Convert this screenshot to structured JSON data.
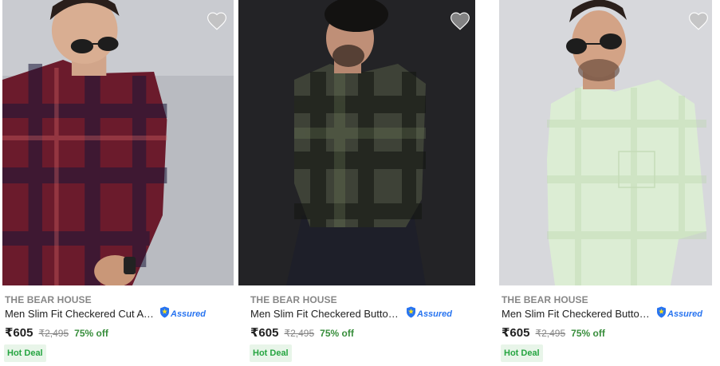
{
  "products": [
    {
      "brand": "THE BEAR HOUSE",
      "title": "Men Slim Fit Checkered Cut Away Collar Casual Shirt",
      "assured": "Assured",
      "price": "₹605",
      "mrp": "₹2,495",
      "discount": "75% off",
      "badge": "Hot Deal",
      "shirt_color": "#6b1b2c",
      "bg_color": "#c9cbd0"
    },
    {
      "brand": "THE BEAR HOUSE",
      "title": "Men Slim Fit Checkered Button Down Collar Casual Shirt",
      "assured": "Assured",
      "price": "₹605",
      "mrp": "₹2,495",
      "discount": "75% off",
      "badge": "Hot Deal",
      "shirt_color": "#3e4237",
      "bg_color": "#1c1c1e"
    },
    {
      "brand": "THE BEAR HOUSE",
      "title": "Men Slim Fit Checkered Button Down Collar Casual Shirt",
      "assured": "Assured",
      "price": "₹605",
      "mrp": "₹2,495",
      "discount": "75% off",
      "badge": "Hot Deal",
      "shirt_color": "#dcedd4",
      "bg_color": "#d7d8dc"
    }
  ],
  "icons": {
    "wishlist": "heart-icon",
    "assured": "shield-icon"
  },
  "colors": {
    "assured_blue": "#2874f0",
    "discount_green": "#388e3c",
    "badge_bg": "#e8f5e9"
  }
}
